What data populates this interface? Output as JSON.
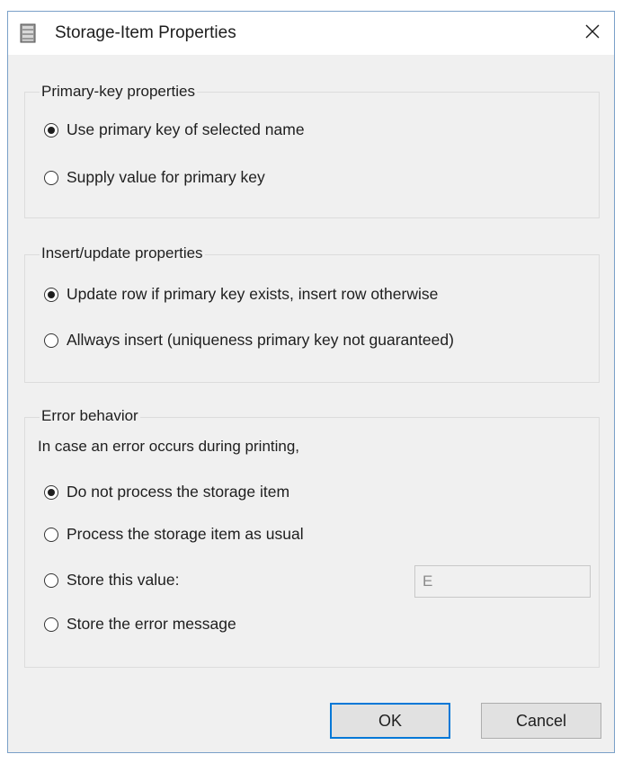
{
  "dialog": {
    "title": "Storage-Item Properties",
    "close_glyph": "✕",
    "icon": "storage-item-icon"
  },
  "primary_key_group": {
    "title": "Primary-key properties",
    "options": [
      {
        "label": "Use primary key of selected name",
        "checked": true
      },
      {
        "label": "Supply value for primary key",
        "checked": false
      }
    ]
  },
  "insert_update_group": {
    "title": "Insert/update properties",
    "options": [
      {
        "label": "Update row if primary key exists, insert row otherwise",
        "checked": true
      },
      {
        "label": "Allways insert (uniqueness primary key not guaranteed)",
        "checked": false
      }
    ]
  },
  "error_group": {
    "title": "Error behavior",
    "description": "In case an error occurs during printing,",
    "options": [
      {
        "label": "Do not process the storage item",
        "checked": true
      },
      {
        "label": "Process the storage item as usual",
        "checked": false
      },
      {
        "label": "Store this value:",
        "checked": false
      },
      {
        "label": "Store the error message",
        "checked": false
      }
    ],
    "store_value": "E"
  },
  "buttons": {
    "ok_label": "OK",
    "cancel_label": "Cancel"
  },
  "colors": {
    "dialog_background": "#f0f0f0",
    "default_button_border": "#0078d7",
    "window_border": "#7aa0c8"
  }
}
